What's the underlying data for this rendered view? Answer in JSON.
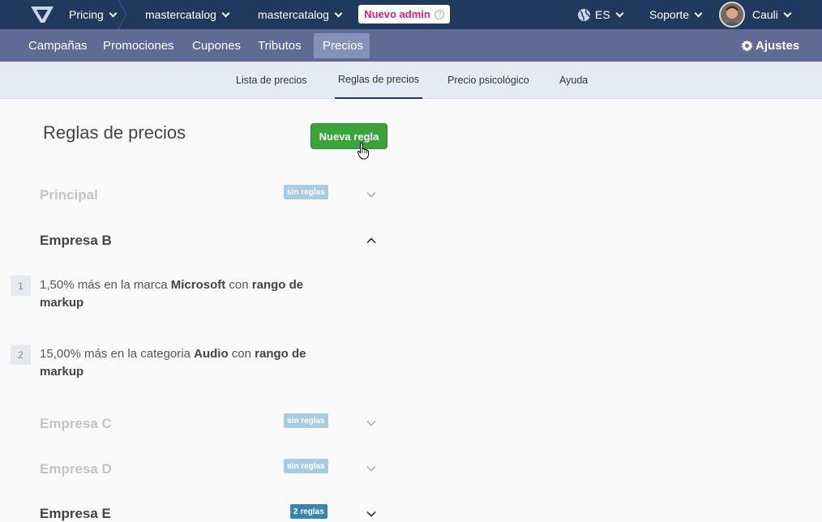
{
  "topbar": {
    "app_name": "Pricing",
    "crumbs": [
      "mastercatalog",
      "mastercatalog"
    ],
    "admin_badge": "Nuevo admin",
    "help_glyph": "?",
    "language": "ES",
    "support": "Soporte",
    "user": "Cauli"
  },
  "mainnav": {
    "items": [
      "Campañas",
      "Promociones",
      "Cupones",
      "Tributos",
      "Precios"
    ],
    "active": "Precios",
    "settings": "Ajustes"
  },
  "subnav": {
    "items": [
      "Lista de precios",
      "Reglas de precios",
      "Precio psicológico",
      "Ayuda"
    ],
    "active": "Reglas de precios"
  },
  "page": {
    "title": "Reglas de precios",
    "new_rule_button": "Nueva regla"
  },
  "companies": [
    {
      "name": "Principal",
      "badge": "sin reglas",
      "expanded": false
    },
    {
      "name": "Empresa B",
      "badge": "",
      "expanded": true,
      "rules": [
        {
          "number": "1",
          "prefix": "1,50% más en la marca ",
          "target": "Microsoft",
          "middle": " con ",
          "tail": "rango de markup"
        },
        {
          "number": "2",
          "prefix": "15,00% más en la categoria ",
          "target": "Audio",
          "middle": " con ",
          "tail": "rango de markup"
        }
      ]
    },
    {
      "name": "Empresa C",
      "badge": "sin reglas",
      "expanded": false
    },
    {
      "name": "Empresa D",
      "badge": "sin reglas",
      "expanded": false
    },
    {
      "name": "Empresa E",
      "badge": "2 reglas",
      "expanded": false
    }
  ],
  "colors": {
    "topbar": "#1f3a5c",
    "mainnav": "#5f6b92",
    "subnav": "#e6ebf3",
    "primary_button": "#3aa43a",
    "admin_badge_text": "#e0206b",
    "badge_empty": "#a9cde0",
    "badge_full": "#3a84b0"
  },
  "icons": [
    "logo-icon",
    "globe-icon",
    "gear-icon",
    "help-icon",
    "chevron-down-icon",
    "chevron-up-icon",
    "hand-cursor-icon"
  ]
}
